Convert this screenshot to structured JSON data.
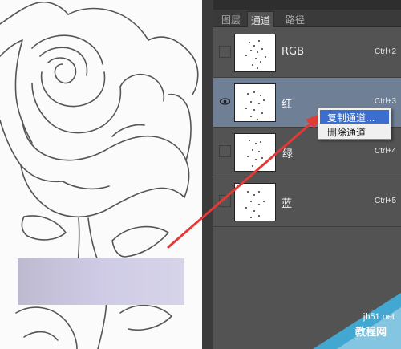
{
  "panel": {
    "tabs": [
      {
        "label": "图层"
      },
      {
        "label": "通道"
      },
      {
        "label": "路径"
      }
    ],
    "channels": [
      {
        "name": "RGB",
        "shortcut": "Ctrl+2",
        "visible": false
      },
      {
        "name": "红",
        "shortcut": "Ctrl+3",
        "visible": true
      },
      {
        "name": "绿",
        "shortcut": "Ctrl+4",
        "visible": false
      },
      {
        "name": "蓝",
        "shortcut": "Ctrl+5",
        "visible": false
      }
    ]
  },
  "context_menu": {
    "items": [
      {
        "label": "复制通道..."
      },
      {
        "label": "删除通道"
      }
    ]
  },
  "watermark": {
    "site": "jb51.net",
    "label": "教程网"
  },
  "colors": {
    "selected_row": "#6e7f96",
    "panel_bg": "#535353",
    "annotation_arrow": "#e53935",
    "menu_highlight": "#3a6fcf"
  }
}
